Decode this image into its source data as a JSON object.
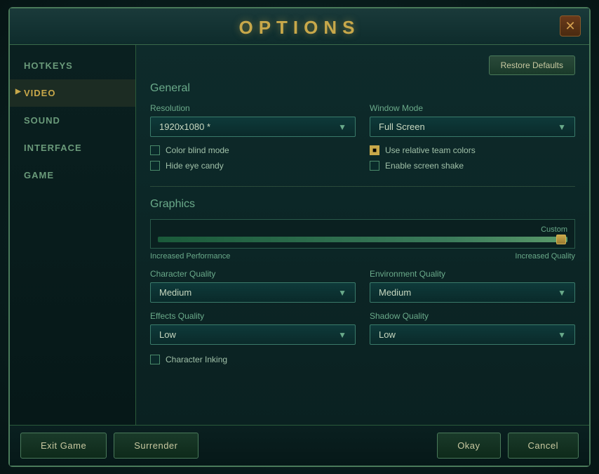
{
  "modal": {
    "title": "OPTIONS",
    "close_label": "✕"
  },
  "sidebar": {
    "items": [
      {
        "id": "hotkeys",
        "label": "HOTKEYS",
        "active": false
      },
      {
        "id": "video",
        "label": "VIDEO",
        "active": true
      },
      {
        "id": "sound",
        "label": "SOUND",
        "active": false
      },
      {
        "id": "interface",
        "label": "INTERFACE",
        "active": false
      },
      {
        "id": "game",
        "label": "GAME",
        "active": false
      }
    ]
  },
  "content": {
    "restore_defaults_label": "Restore Defaults",
    "general_section": "General",
    "resolution_label": "Resolution",
    "resolution_value": "1920x1080 *",
    "window_mode_label": "Window Mode",
    "window_mode_value": "Full Screen",
    "color_blind_label": "Color blind mode",
    "color_blind_checked": false,
    "hide_eye_candy_label": "Hide eye candy",
    "hide_eye_candy_checked": false,
    "use_relative_label": "Use relative team colors",
    "use_relative_checked": true,
    "enable_screen_shake_label": "Enable screen shake",
    "enable_screen_shake_checked": false,
    "graphics_section": "Graphics",
    "slider_label": "Custom",
    "slider_increased_performance": "Increased Performance",
    "slider_increased_quality": "Increased Quality",
    "character_quality_label": "Character Quality",
    "character_quality_value": "Medium",
    "environment_quality_label": "Environment Quality",
    "environment_quality_value": "Medium",
    "effects_quality_label": "Effects Quality",
    "effects_quality_value": "Low",
    "shadow_quality_label": "Shadow Quality",
    "shadow_quality_value": "Low",
    "character_inking_label": "Character Inking",
    "character_inking_checked": false
  },
  "footer": {
    "exit_game_label": "Exit Game",
    "surrender_label": "Surrender",
    "okay_label": "Okay",
    "cancel_label": "Cancel"
  }
}
